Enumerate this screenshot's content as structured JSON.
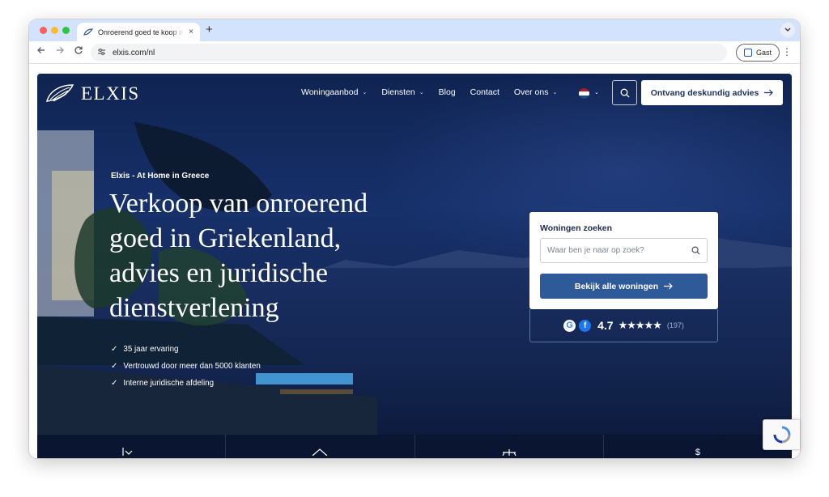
{
  "browser": {
    "tab_title": "Onroerend goed te koop in Griekenland",
    "tab_close": "×",
    "new_tab": "+",
    "url": "elxis.com/nl",
    "profile_label": "Gast"
  },
  "site": {
    "logo_text": "ELXIS",
    "nav": [
      {
        "label": "Woningaanbod",
        "has_dropdown": true
      },
      {
        "label": "Diensten",
        "has_dropdown": true
      },
      {
        "label": "Blog",
        "has_dropdown": false
      },
      {
        "label": "Contact",
        "has_dropdown": false
      },
      {
        "label": "Over ons",
        "has_dropdown": true
      }
    ],
    "language_flag": "nl-flag",
    "cta_label": "Ontvang deskundig advies"
  },
  "hero": {
    "eyebrow": "Elxis - At Home in Greece",
    "headline": "Verkoop van onroerend goed in Griekenland, advies en juridische dienstverlening",
    "benefits": [
      "35 jaar ervaring",
      "Vertrouwd door meer dan 5000 klanten",
      "Interne juridische afdeling"
    ]
  },
  "search": {
    "title": "Woningen zoeken",
    "placeholder": "Waar ben je naar op zoek?",
    "button_label": "Bekijk alle woningen"
  },
  "rating": {
    "score": "4.7",
    "stars_text": "★★★★★",
    "stars_value": 4.7,
    "count": "(197)"
  },
  "colors": {
    "brand_navy": "#1b3262",
    "button_blue": "#2f5a9a",
    "hero_bg": "#16306a"
  }
}
